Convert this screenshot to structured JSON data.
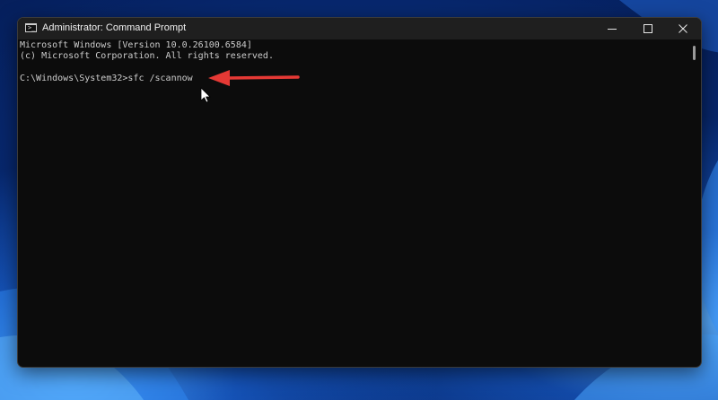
{
  "window": {
    "title": "Administrator: Command Prompt"
  },
  "icons": {
    "app_icon": "command-prompt-icon",
    "minimize": "minimize-icon",
    "maximize": "maximize-icon",
    "close": "close-icon",
    "annotation_arrow": "red-arrow-icon",
    "cursor": "mouse-pointer-icon"
  },
  "terminal": {
    "lines": [
      "Microsoft Windows [Version 10.0.26100.6584]",
      "(c) Microsoft Corporation. All rights reserved.",
      "C:\\Windows\\System32>sfc /scannow"
    ]
  },
  "colors": {
    "terminal_background": "#0c0c0c",
    "terminal_text": "#cccccc",
    "titlebar": "#1f1f1f",
    "annotation_arrow": "#e53935"
  }
}
